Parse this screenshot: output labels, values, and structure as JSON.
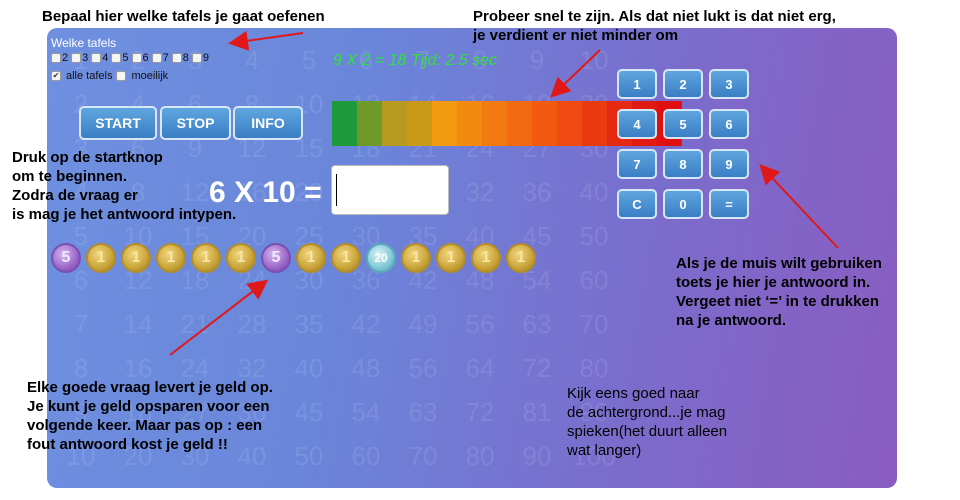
{
  "annotations": {
    "tables_hint": "Bepaal hier welke tafels je gaat oefenen",
    "speed_hint": "Probeer snel te zijn. Als dat niet lukt is dat niet erg,\nje verdient er niet minder om",
    "start_hint": "Druk op de startknop\nom te beginnen.\nZodra de vraag er\nis mag je het antwoord intypen.",
    "mouse_hint": "Als je de muis wilt gebruiken\ntoets je hier je antwoord in.\nVergeet niet ‘=’ in te drukken\nna je antwoord.",
    "money_hint": "Elke goede vraag levert je geld op.\nJe kunt je geld opsparen voor een\nvolgende keer. Maar pas op : een\nfout antwoord kost je geld !!",
    "background_hint": "Kijk eens goed naar\nde achtergrond...je mag\nspieken(het duurt alleen\nwat langer)"
  },
  "tables": {
    "title": "Welke tafels",
    "options": [
      {
        "label": "2",
        "checked": false
      },
      {
        "label": "3",
        "checked": false
      },
      {
        "label": "4",
        "checked": false
      },
      {
        "label": "5",
        "checked": false
      },
      {
        "label": "6",
        "checked": false
      },
      {
        "label": "7",
        "checked": false
      },
      {
        "label": "8",
        "checked": false
      },
      {
        "label": "9",
        "checked": false
      }
    ],
    "all_label": "alle tafels",
    "all_checked": true,
    "hard_label": "moeilijk",
    "hard_checked": false
  },
  "buttons": {
    "start": "START",
    "stop": "STOP",
    "info": "INFO"
  },
  "last_problem": "9 X 2 = 18 Tijd: 2.5 sec",
  "question": "6 X 10 =",
  "answer_value": "",
  "timebar_colors": [
    "#1f9a3a",
    "#6f9a2a",
    "#b89a20",
    "#c99a18",
    "#f29a10",
    "#f28a10",
    "#f27a10",
    "#f26a10",
    "#f25a10",
    "#f04a10",
    "#e93a10",
    "#e32a10",
    "#e01a10",
    "#e01010"
  ],
  "keypad": [
    "1",
    "2",
    "3",
    "4",
    "5",
    "6",
    "7",
    "8",
    "9",
    "C",
    "0",
    "="
  ],
  "coins": [
    {
      "value": "5",
      "type": "purple"
    },
    {
      "value": "1",
      "type": "gold"
    },
    {
      "value": "1",
      "type": "gold"
    },
    {
      "value": "1",
      "type": "gold"
    },
    {
      "value": "1",
      "type": "gold"
    },
    {
      "value": "1",
      "type": "gold"
    },
    {
      "value": "5",
      "type": "purple"
    },
    {
      "value": "1",
      "type": "gold"
    },
    {
      "value": "1",
      "type": "gold"
    },
    {
      "value": "20",
      "type": "teal"
    },
    {
      "value": "1",
      "type": "gold"
    },
    {
      "value": "1",
      "type": "gold"
    },
    {
      "value": "1",
      "type": "gold"
    },
    {
      "value": "1",
      "type": "gold"
    }
  ],
  "background_numbers": [
    [
      "1",
      "2",
      "3",
      "4",
      "5",
      "6",
      "7",
      "8",
      "9",
      "10",
      "",
      "",
      "",
      "",
      "",
      ""
    ],
    [
      "2",
      "4",
      "6",
      "8",
      "10",
      "12",
      "14",
      "16",
      "18",
      "20",
      "",
      "",
      "",
      "",
      "",
      ""
    ],
    [
      "3",
      "6",
      "9",
      "12",
      "15",
      "18",
      "21",
      "24",
      "27",
      "30",
      "",
      "",
      "",
      "",
      "",
      ""
    ],
    [
      "4",
      "8",
      "12",
      "16",
      "20",
      "24",
      "28",
      "32",
      "36",
      "40",
      "",
      "",
      "",
      "",
      "",
      ""
    ],
    [
      "5",
      "10",
      "15",
      "20",
      "25",
      "30",
      "35",
      "40",
      "45",
      "50",
      "",
      "",
      "",
      "",
      "",
      ""
    ],
    [
      "6",
      "12",
      "18",
      "24",
      "30",
      "36",
      "42",
      "48",
      "54",
      "60",
      "",
      "",
      "",
      "",
      "",
      ""
    ],
    [
      "7",
      "14",
      "21",
      "28",
      "35",
      "42",
      "49",
      "56",
      "63",
      "70",
      "",
      "",
      "",
      "",
      "",
      ""
    ],
    [
      "8",
      "16",
      "24",
      "32",
      "40",
      "48",
      "56",
      "64",
      "72",
      "80",
      "",
      "",
      "",
      "",
      "",
      ""
    ],
    [
      "9",
      "18",
      "27",
      "36",
      "45",
      "54",
      "63",
      "72",
      "81",
      "90",
      "",
      "",
      "",
      "",
      "",
      ""
    ],
    [
      "10",
      "20",
      "30",
      "40",
      "50",
      "60",
      "70",
      "80",
      "90",
      "100",
      "",
      "",
      "",
      "",
      "",
      ""
    ]
  ]
}
